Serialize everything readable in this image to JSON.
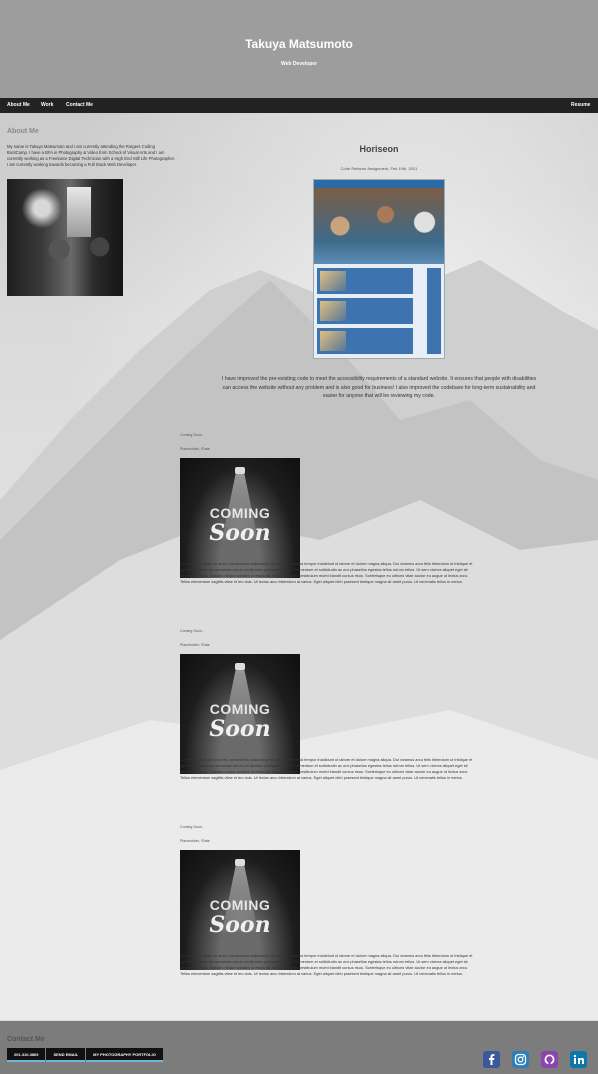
{
  "header": {
    "name": "Takuya Matsumoto",
    "role": "Web Developer"
  },
  "nav": {
    "about": "About Me",
    "work": "Work",
    "contact": "Contact Me",
    "resume": "Resume"
  },
  "about": {
    "heading": "About Me",
    "text": "My name is Takuya Matsumoto and I am currently attending the Rutgers Coding BootCamp. I have a BFA in Photography & Video from School of Visual Arts and I am currently working as a Freelance Digital Technician with a High End Still Life Photographer. I am currently working towards becoming a Full Stack Web Developer."
  },
  "project": {
    "title": "Horiseon",
    "subtitle": "Code Refactor Assignment, Feb 10th, 2021",
    "description": "I have improved the pre-existing code to meet the accessibility requirements of a standard website. It ensures that people with disabilities can access the website without any problem and is also good for business! I also improved the codebase for long-term sustainability and easier for anyone that will be reviewing my code."
  },
  "cards": [
    {
      "status": "Coming Soon..",
      "date": "Placeholder, *Date",
      "image_word_1": "COMING",
      "image_word_2": "Soon",
      "text": "Lorem ipsum dolor sit amet, consectetur adipiscing elit, sed do eiusmod tempor incididunt ut labore et dolore magna aliqua. Dui vivamus arcu felis bibendum ut tristique et egestas. Maecenas accumsan lacus vel facilisis volutpat est velit. Fermentum et sollicitudin ac orci phasellus egestas tellus rutrum tellus. Ut sem viverra aliquet eget sit amet tellus cras. Sodales neque sodales ut etiam sit. Neque aliquam vestibulum morbi blandit cursus risus. Scelerisque eu ultrices vitae auctor eu augue ut lectus arcu. Tellus elementum sagittis vitae et leo duis. Ut lectus arcu bibendum at varius. Eget aliquet nibh praesent tristique magna sit amet purus. Ut venenatis tellus in metus."
    },
    {
      "status": "Coming Soon..",
      "date": "Placeholder, *Date",
      "image_word_1": "COMING",
      "image_word_2": "Soon",
      "text": "Lorem ipsum dolor sit amet, consectetur adipiscing elit, sed do eiusmod tempor incididunt ut labore et dolore magna aliqua. Dui vivamus arcu felis bibendum ut tristique et egestas. Maecenas accumsan lacus vel facilisis volutpat est velit. Fermentum et sollicitudin ac orci phasellus egestas tellus rutrum tellus. Ut sem viverra aliquet eget sit amet tellus cras. Sodales neque sodales ut etiam sit. Neque aliquam vestibulum morbi blandit cursus risus. Scelerisque eu ultrices vitae auctor eu augue ut lectus arcu. Tellus elementum sagittis vitae et leo duis. Ut lectus arcu bibendum at varius. Eget aliquet nibh praesent tristique magna sit amet purus. Ut venenatis tellus in metus."
    },
    {
      "status": "Coming Soon..",
      "date": "Placeholder, *Date",
      "image_word_1": "COMING",
      "image_word_2": "Soon",
      "text": "Lorem ipsum dolor sit amet, consectetur adipiscing elit, sed do eiusmod tempor incididunt ut labore et dolore magna aliqua. Dui vivamus arcu felis bibendum ut tristique et egestas. Maecenas accumsan lacus vel facilisis volutpat est velit. Fermentum et sollicitudin ac orci phasellus egestas tellus rutrum tellus. Ut sem viverra aliquet eget sit amet tellus cras. Sodales neque sodales ut etiam sit. Neque aliquam vestibulum morbi blandit cursus risus. Scelerisque eu ultrices vitae auctor eu augue ut lectus arcu. Tellus elementum sagittis vitae et leo duis. Ut lectus arcu bibendum at varius. Eget aliquet nibh praesent tristique magna sit amet purus. Ut venenatis tellus in metus."
    }
  ],
  "contact": {
    "heading": "Contact Me",
    "phone": "201.310.3869",
    "email": "SEND EMAIL",
    "portfolio": "MY PHOTOGRAPHY PORTFOLIO"
  },
  "social": [
    {
      "icon": "facebook-icon",
      "color": "#3b5998"
    },
    {
      "icon": "instagram-icon",
      "color": "#2c7fb8"
    },
    {
      "icon": "github-icon",
      "color": "#8e44ad"
    },
    {
      "icon": "linkedin-icon",
      "color": "#0e76a8"
    }
  ]
}
